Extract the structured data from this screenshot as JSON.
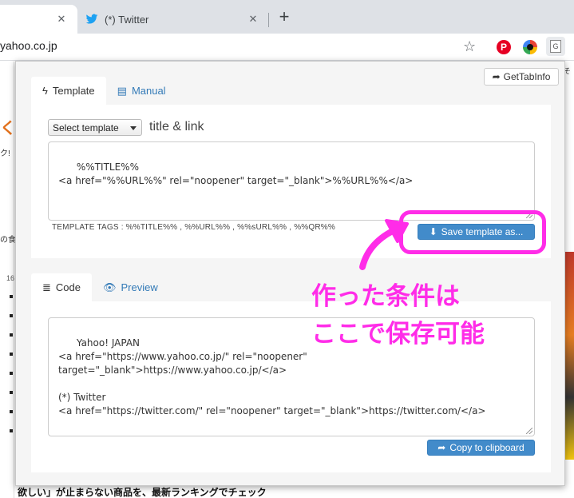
{
  "browser": {
    "tabs": [
      {
        "title": "",
        "active": true
      },
      {
        "title": "(*) Twitter",
        "active": false
      }
    ],
    "url": "yahoo.co.jp",
    "extensions": [
      "pinterest-icon",
      "color-dial-icon",
      "gettabinfo-icon"
    ],
    "gti_badge": "G"
  },
  "background": {
    "orange_glyph": "く",
    "click_text": "ク!",
    "food_text": "の食",
    "number": "16",
    "right_text": "そ",
    "bottom_text": "欲しい」が止まらない商品を、最新ランキングでチェック"
  },
  "popup": {
    "gettabinfo_label": "GetTabInfo",
    "template_panel": {
      "tabs": [
        {
          "label": "Template",
          "icon": "bolt-icon",
          "active": true
        },
        {
          "label": "Manual",
          "icon": "list-icon",
          "active": false
        }
      ],
      "select_label": "Select template",
      "template_name": "title & link",
      "template_text": "%%TITLE%%\n<a href=\"%%URL%%\" rel=\"noopener\" target=\"_blank\">%%URL%%</a>",
      "tags_label": "TEMPLATE TAGS : %%TITLE%% , %%URL%% , %%sURL%% , %%QR%%",
      "save_label": "Save template as..."
    },
    "code_panel": {
      "tabs": [
        {
          "label": "Code",
          "icon": "lines-icon",
          "active": true
        },
        {
          "label": "Preview",
          "icon": "eye-icon",
          "active": false
        }
      ],
      "code_text": "Yahoo! JAPAN\n<a href=\"https://www.yahoo.co.jp/\" rel=\"noopener\"\ntarget=\"_blank\">https://www.yahoo.co.jp/</a>\n\n(*) Twitter\n<a href=\"https://twitter.com/\" rel=\"noopener\" target=\"_blank\">https://twitter.com/</a>",
      "copy_label": "Copy to clipboard"
    }
  },
  "annotation": {
    "line1": "作った条件は",
    "line2": "ここで保存可能",
    "color": "#ff2ce8"
  }
}
